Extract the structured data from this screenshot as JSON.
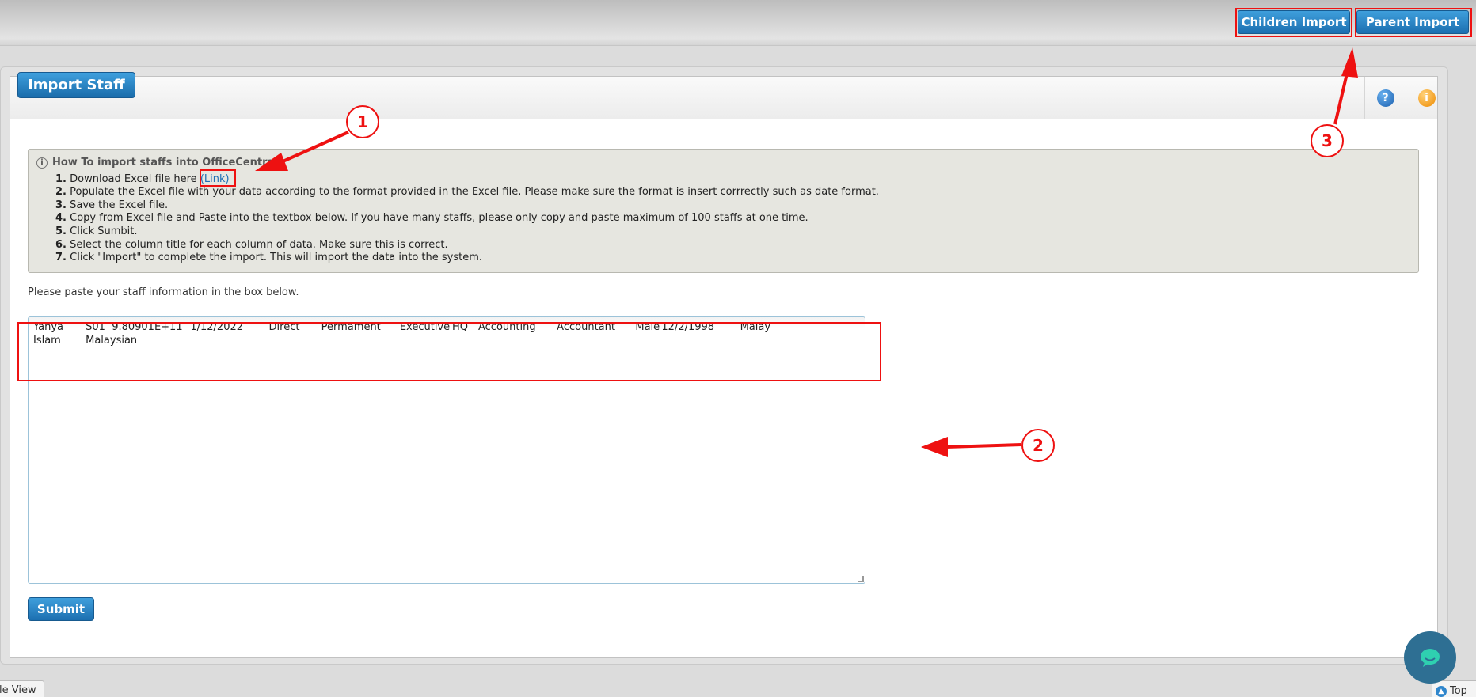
{
  "topbar": {
    "children_import_label": "Children Import",
    "parent_import_label": "Parent Import"
  },
  "panel": {
    "title": "Import Staff",
    "help_icon": "help-icon",
    "info_icon": "info-icon"
  },
  "howto": {
    "title": "How To import staffs into OfficeCentral?",
    "steps": [
      {
        "num": "1.",
        "text": "Download Excel file here ",
        "link": "(Link)"
      },
      {
        "num": "2.",
        "text": "Populate the Excel file with your data according to the format provided in the Excel file. Please make sure the format is insert corrrectly such as date format."
      },
      {
        "num": "3.",
        "text": "Save the Excel file."
      },
      {
        "num": "4.",
        "text": "Copy from Excel file and Paste into the textbox below. If you have many staffs, please only copy and paste maximum of 100 staffs at one time."
      },
      {
        "num": "5.",
        "text": "Click Sumbit."
      },
      {
        "num": "6.",
        "text": "Select the column title for each column of data. Make sure this is correct."
      },
      {
        "num": "7.",
        "text": "Click \"Import\" to complete the import. This will import the data into the system."
      }
    ]
  },
  "paste_label": "Please paste your staff information in the box below.",
  "textarea_value": "Yahya\tS01\t9.80901E+11\t1/12/2022\tDirect\tPermament\tExecutive\tHQ\tAccounting\tAccountant\tMale\t12/2/1998\tMalay\nIslam\tMalaysian",
  "submit_label": "Submit",
  "footer": {
    "left_label": "le View",
    "right_label": "Top"
  },
  "annotations": [
    "1",
    "2",
    "3"
  ],
  "colors": {
    "button_blue": "#1c6fb0",
    "annotation_red": "#e11111"
  }
}
